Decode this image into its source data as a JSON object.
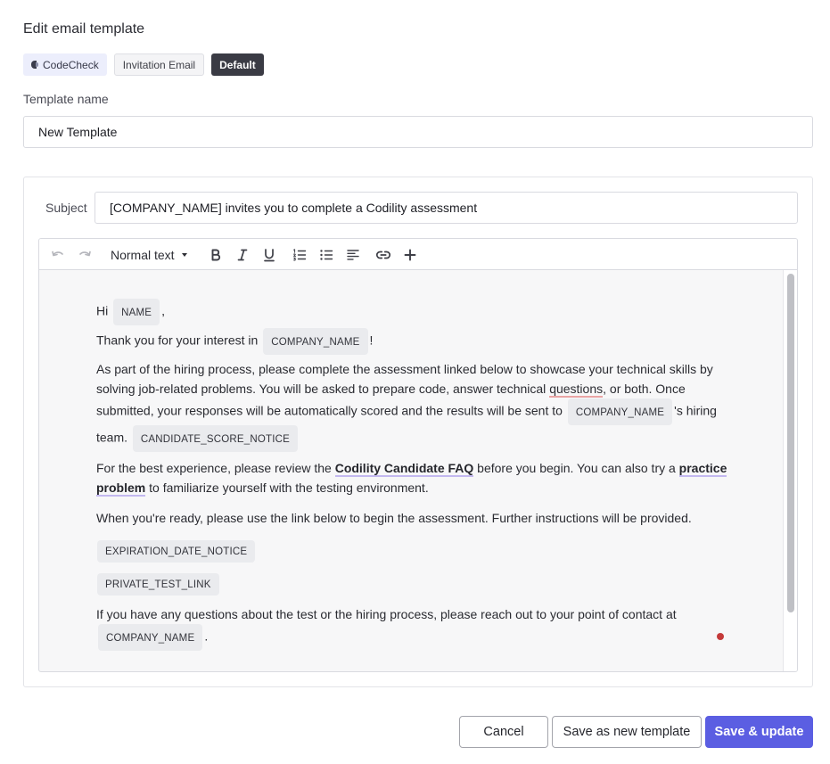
{
  "header": {
    "title": "Edit email template"
  },
  "tags": {
    "product": "CodeCheck",
    "type": "Invitation Email",
    "badge": "Default"
  },
  "template_name": {
    "label": "Template name",
    "value": "New Template"
  },
  "subject": {
    "label": "Subject",
    "value": "[COMPANY_NAME] invites you to complete a Codility assessment"
  },
  "toolbar": {
    "text_style": "Normal text",
    "icons": [
      "undo-icon",
      "redo-icon",
      "bold-icon",
      "italic-icon",
      "underline-icon",
      "numbered-list-icon",
      "bullet-list-icon",
      "align-left-icon",
      "link-icon",
      "plus-icon"
    ]
  },
  "body": {
    "p1_pre": "Hi",
    "var_name": "NAME",
    "p1_post": ",",
    "p2_pre": "Thank you for your interest in",
    "var_company_1": "COMPANY_NAME",
    "p2_post": "!",
    "p3_a": "As part of the hiring process, please complete the assessment linked below to showcase your technical skills by solving job-related problems. You will be asked to prepare code, answer technical ",
    "p3_spell": "questions",
    "p3_b": ", or both. Once submitted, your responses will be automatically scored and the results will be sent to",
    "var_company_2": "COMPANY_NAME",
    "p3_c": "'s hiring team.",
    "var_score": "CANDIDATE_SCORE_NOTICE",
    "p4_a": "For the best experience, please review the ",
    "p4_link1": "Codility Candidate FAQ",
    "p4_b": " before you begin. You can also try a ",
    "p4_link2": "practice problem",
    "p4_c": " to familiarize yourself with the testing environment.",
    "p5": "When you're ready, please use the link below to begin the assessment. Further instructions will be provided.",
    "var_expiration": "EXPIRATION_DATE_NOTICE",
    "var_link": "PRIVATE_TEST_LINK",
    "p6_a": "If you have any questions about the test or the hiring process, please reach out to your point of contact at",
    "var_company_3": "COMPANY_NAME",
    "p6_b": "."
  },
  "buttons": {
    "cancel": "Cancel",
    "save_new": "Save as new template",
    "save_update": "Save & update"
  },
  "colors": {
    "primary": "#5b5ee2",
    "dark_badge": "#3a3b44",
    "link_underline": "#c3b8f0",
    "spell_underline": "#e9a4a4"
  }
}
